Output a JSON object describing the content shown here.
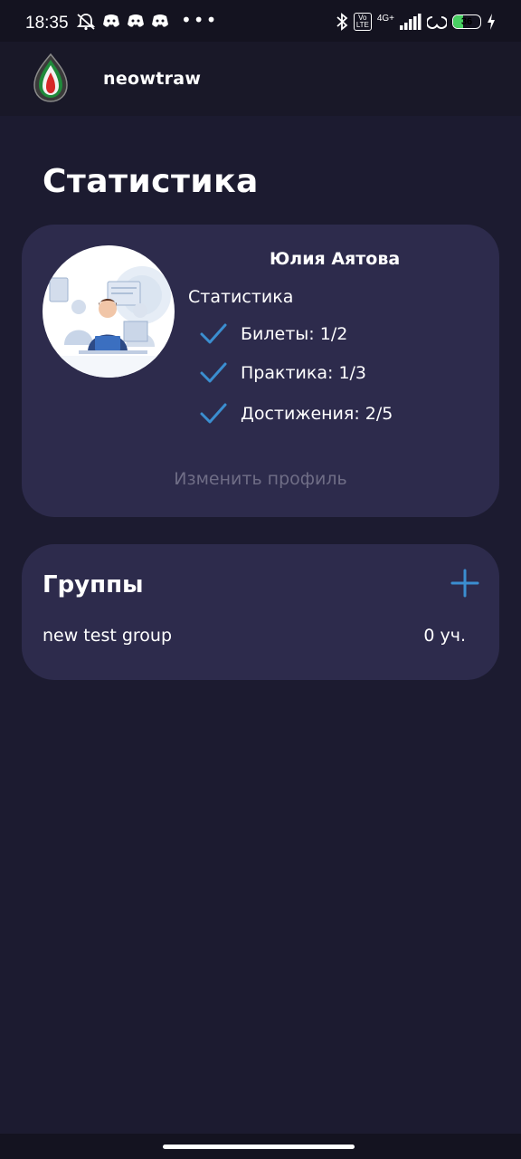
{
  "status_bar": {
    "time": "18:35",
    "dots": "•••",
    "network": "4G+",
    "volte": "Vo LTE",
    "battery": "36",
    "battery_level_percent": 36,
    "battery_color": "#48d062"
  },
  "header": {
    "app_name": "neowtraw",
    "logo_icon": "flame-logo-icon"
  },
  "page": {
    "title": "Статистика"
  },
  "profile": {
    "name": "Юлия Аятова",
    "stats_heading": "Статистика",
    "stats": [
      {
        "label": "Билеты: 1/2"
      },
      {
        "label": "Практика: 1/3"
      },
      {
        "label": "Достижения: 2/5"
      }
    ],
    "edit_label": "Изменить профиль"
  },
  "groups": {
    "title": "Группы",
    "add_icon": "plus-icon",
    "items": [
      {
        "name": "new test group",
        "count": "0 уч."
      }
    ]
  },
  "colors": {
    "background": "#1c1b30",
    "card": "#2d2b4c",
    "accent": "#3b8ed0",
    "muted_text": "#6f6d86"
  }
}
